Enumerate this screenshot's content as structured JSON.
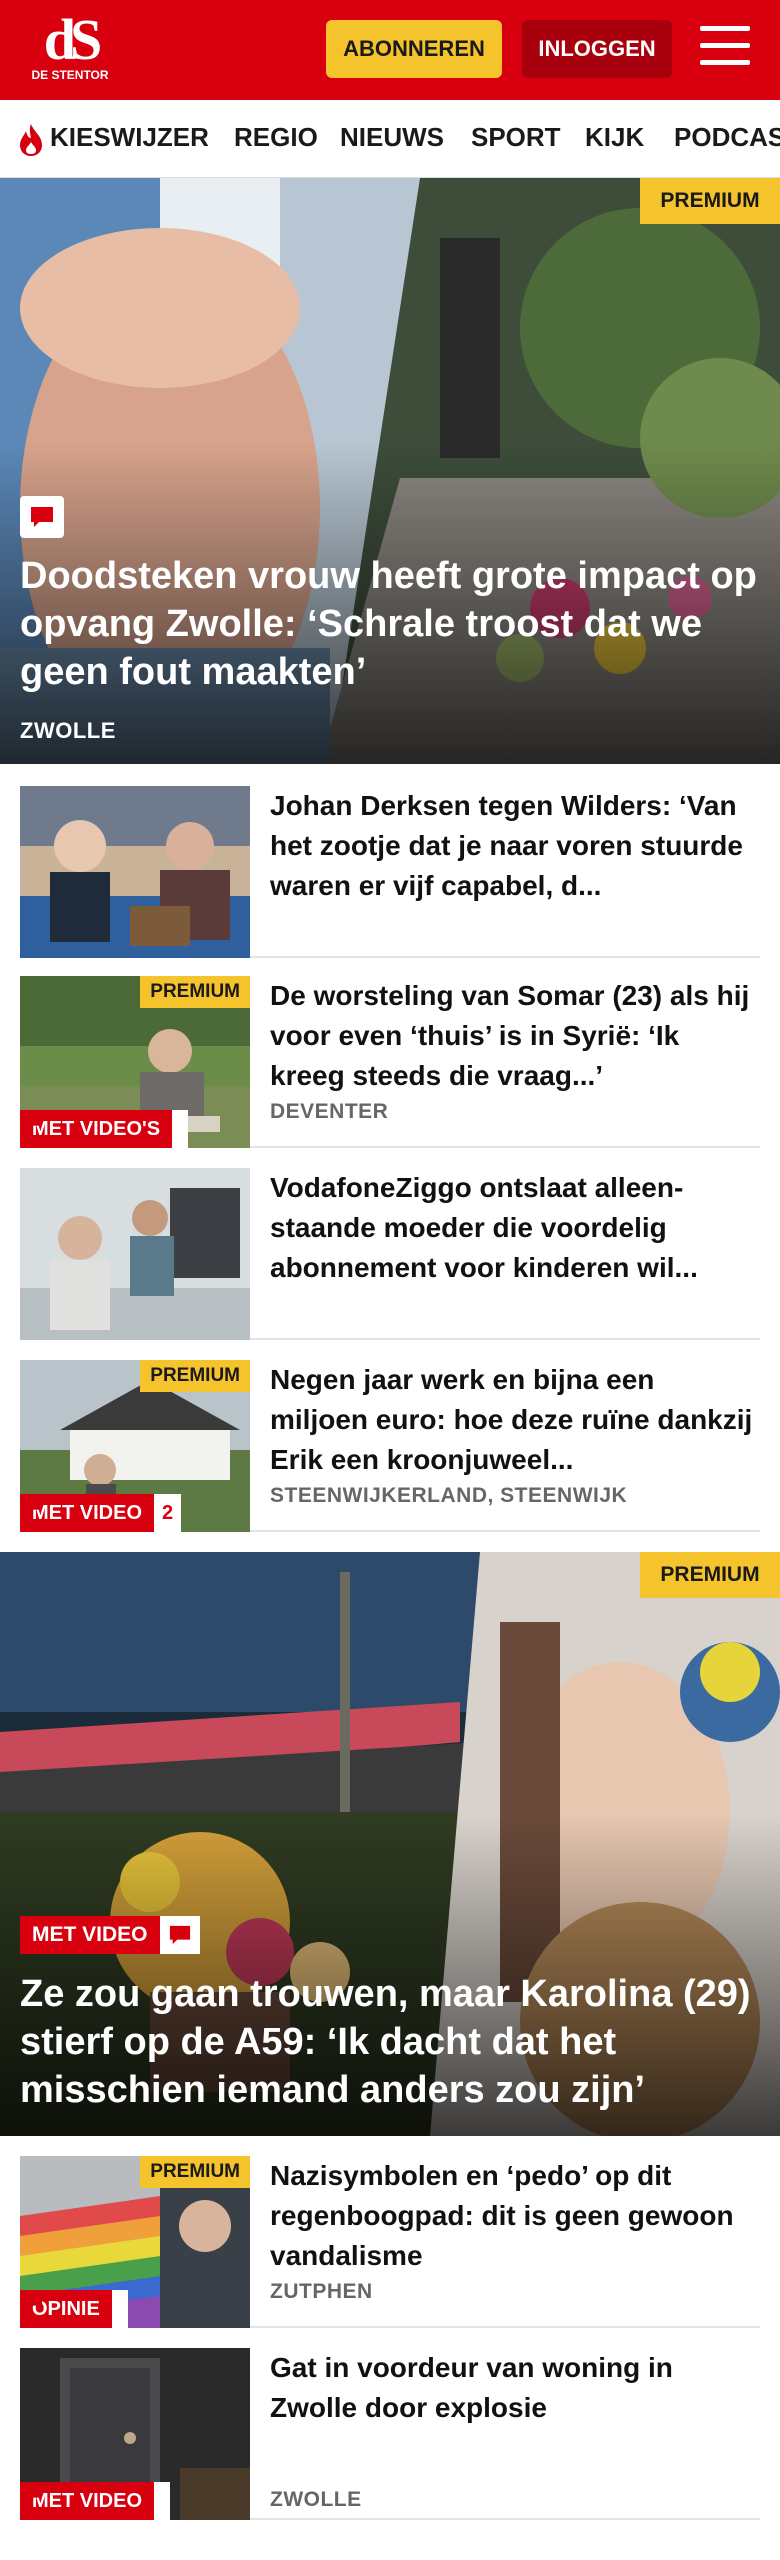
{
  "header": {
    "logo_mark": "dS",
    "logo_text": "DE STENTOR",
    "subscribe_label": "ABONNEREN",
    "login_label": "INLOGGEN",
    "brand_color": "#d8000f"
  },
  "nav": {
    "items": [
      "KIESWIJZER",
      "REGIO",
      "NIEUWS",
      "SPORT",
      "KIJK",
      "PODCAST"
    ]
  },
  "hero1": {
    "badge": "PREMIUM",
    "title": "Doodsteken vrouw heeft grote impact op opvang Zwolle: ‘Schrale troost dat we geen fout maakten’",
    "location": "ZWOLLE"
  },
  "articles": [
    {
      "title": "Johan Derksen tegen Wilders: ‘Van het zootje dat je naar voren stuurde waren er vijf capabel, d...",
      "location": ""
    },
    {
      "badge": "PREMIUM",
      "tag": "MET VIDEO'S",
      "title": "De worsteling van Somar (23) als hij voor even ‘thuis’ is in Syrië: ‘Ik kreeg steeds die vraag...’",
      "location": "DEVENTER"
    },
    {
      "title": "VodafoneZiggo ontslaat alleen- staande moeder die voordelig abonnement voor kinderen wil...",
      "location": ""
    },
    {
      "badge": "PREMIUM",
      "tag": "MET VIDEO",
      "comments": "2",
      "title": "Negen jaar werk en bijna een miljoen euro: hoe deze ruïne dankzij Erik een kroonjuweel...",
      "location": "STEENWIJKERLAND, STEENWIJK"
    }
  ],
  "hero2": {
    "badge": "PREMIUM",
    "tag": "MET VIDEO",
    "title": "Ze zou gaan trouwen, maar Karolina (29) stierf op de A59: ‘Ik dacht dat het misschien iemand anders zou zijn’"
  },
  "articles2": [
    {
      "badge": "PREMIUM",
      "tag": "OPINIE",
      "title": "Nazisymbolen en ‘pedo’ op dit regenboogpad: dit is geen gewoon vandalisme",
      "location": "ZUTPHEN"
    },
    {
      "tag": "MET VIDEO",
      "title": "Gat in voordeur van woning in Zwolle door explosie",
      "location": "ZWOLLE"
    }
  ]
}
